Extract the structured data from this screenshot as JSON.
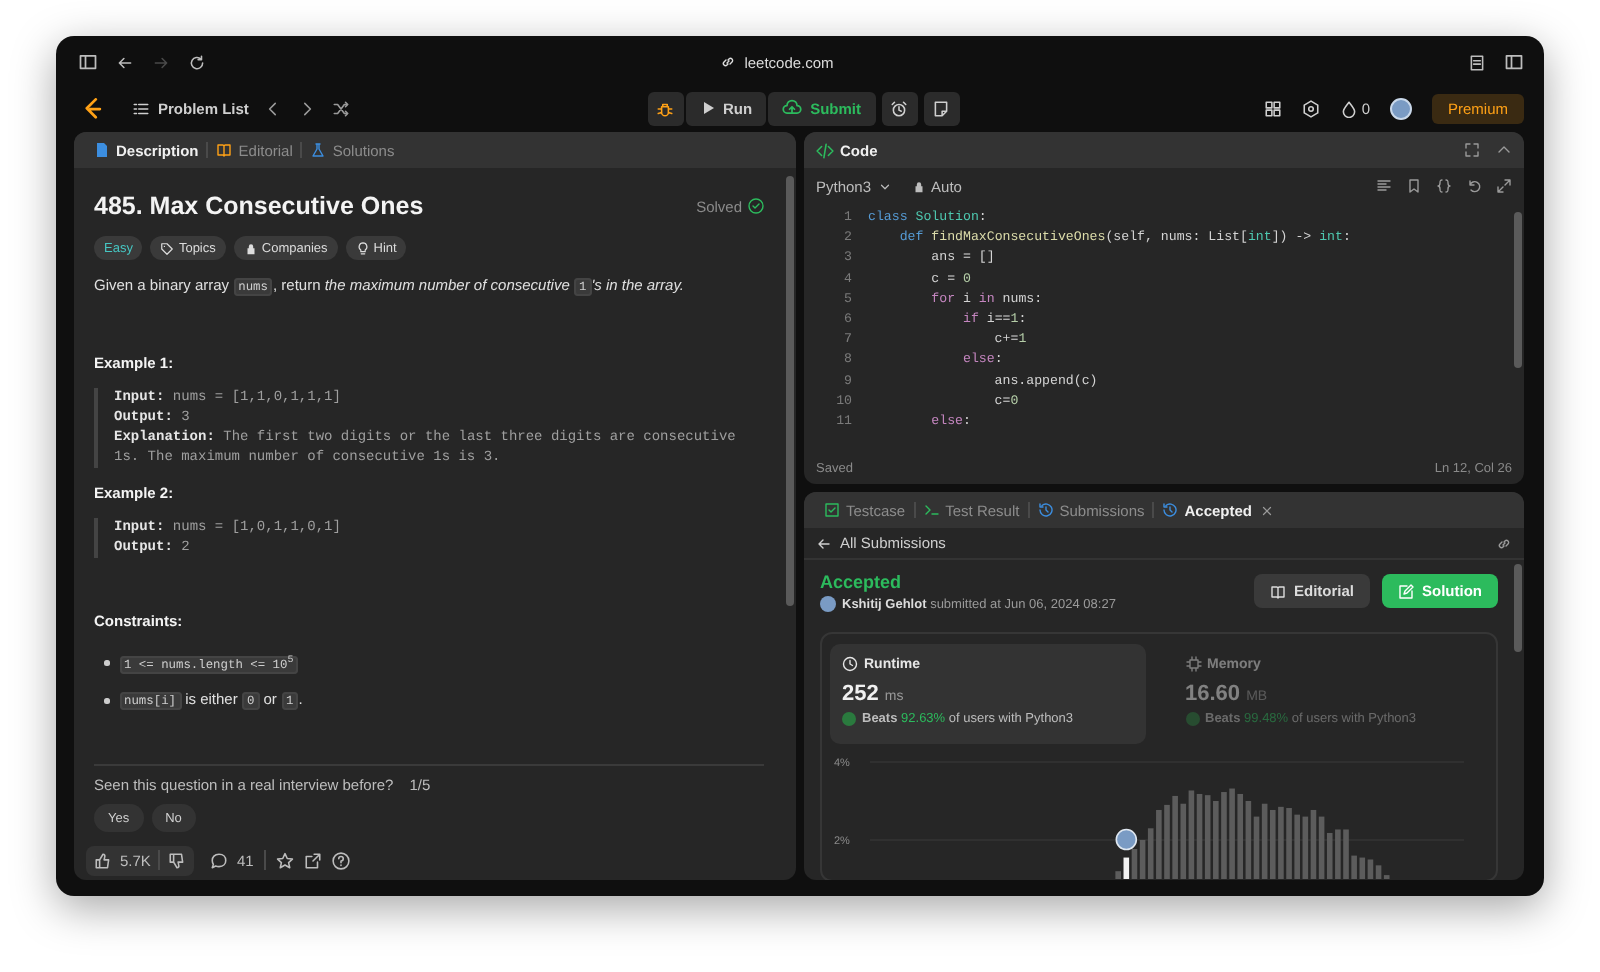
{
  "browser": {
    "url": "leetcode.com",
    "forward_disabled": true
  },
  "nav": {
    "problem_list": "Problem List",
    "run": "Run",
    "submit": "Submit",
    "streak_count": "0",
    "premium": "Premium"
  },
  "left_panel": {
    "tabs": [
      {
        "label": "Description",
        "selected": true
      },
      {
        "label": "Editorial",
        "selected": false
      },
      {
        "label": "Solutions",
        "selected": false
      }
    ],
    "title": "485. Max Consecutive Ones",
    "status": "Solved",
    "tags": [
      {
        "label": "Easy",
        "kind": "difficulty"
      },
      {
        "label": "Topics",
        "kind": "topics"
      },
      {
        "label": "Companies",
        "kind": "companies"
      },
      {
        "label": "Hint",
        "kind": "hint"
      }
    ],
    "statement": [
      {
        "text": "Given a binary array ",
        "kind": "text"
      },
      {
        "text": "nums",
        "kind": "code"
      },
      {
        "text": ", return ",
        "kind": "text"
      },
      {
        "text": "the maximum number of consecutive ",
        "kind": "italic"
      },
      {
        "text": "1",
        "kind": "code"
      },
      {
        "text": "'s in the array.",
        "kind": "italic"
      }
    ],
    "examples": [
      {
        "heading": "Example 1:",
        "lines": [
          {
            "label": "Input:",
            "value": "nums = [1,1,0,1,1,1]"
          },
          {
            "label": "Output:",
            "value": "3"
          },
          {
            "label": "Explanation:",
            "value": "The first two digits or the last three digits are consecutive 1s. The maximum number of consecutive 1s is 3."
          }
        ]
      },
      {
        "heading": "Example 2:",
        "lines": [
          {
            "label": "Input:",
            "value": "nums = [1,0,1,1,0,1]"
          },
          {
            "label": "Output:",
            "value": "2"
          }
        ]
      }
    ],
    "constraints_heading": "Constraints:",
    "constraints": [
      [
        {
          "text": "1 <= nums.length <= 10$^{5}$",
          "kind": "code"
        }
      ],
      [
        {
          "text": "nums[i]",
          "kind": "code"
        },
        {
          "text": " is either ",
          "kind": "text"
        },
        {
          "text": "0",
          "kind": "code"
        },
        {
          "text": " or ",
          "kind": "text"
        },
        {
          "text": "1",
          "kind": "code"
        },
        {
          "text": ".",
          "kind": "text"
        }
      ]
    ],
    "interview": {
      "question": "Seen this question in a real interview before?",
      "count": "1/5",
      "answers": [
        "Yes",
        "No"
      ]
    },
    "footer": {
      "likes": "5.7K",
      "comments": "41"
    }
  },
  "editor": {
    "title": "Code",
    "language": "Python3",
    "mode": "Auto",
    "lines": [
      {
        "number": "1",
        "tokens": [
          {
            "text": "class",
            "kind": "keyword"
          },
          {
            "text": " Solution",
            "kind": "type"
          },
          {
            "text": ":",
            "kind": "plain"
          }
        ]
      },
      {
        "number": "2",
        "tokens": [
          {
            "text": "    def",
            "kind": "keyword"
          },
          {
            "text": " findMaxConsecutiveOnes",
            "kind": "function"
          },
          {
            "text": "(self, nums: List[",
            "kind": "plain"
          },
          {
            "text": "int",
            "kind": "type"
          },
          {
            "text": "]) -> ",
            "kind": "plain"
          },
          {
            "text": "int",
            "kind": "type"
          },
          {
            "text": ":",
            "kind": "plain"
          }
        ]
      },
      {
        "number": "3",
        "tokens": [
          {
            "text": "        ans = []",
            "kind": "plain"
          }
        ]
      },
      {
        "number": "4",
        "tokens": [
          {
            "text": "        c = ",
            "kind": "plain"
          },
          {
            "text": "0",
            "kind": "number"
          }
        ]
      },
      {
        "number": "5",
        "tokens": [
          {
            "text": "        for",
            "kind": "control"
          },
          {
            "text": " i ",
            "kind": "plain"
          },
          {
            "text": "in",
            "kind": "control"
          },
          {
            "text": " nums:",
            "kind": "plain"
          }
        ]
      },
      {
        "number": "6",
        "tokens": [
          {
            "text": "            if",
            "kind": "control"
          },
          {
            "text": " i==",
            "kind": "plain"
          },
          {
            "text": "1",
            "kind": "number"
          },
          {
            "text": ":",
            "kind": "plain"
          }
        ]
      },
      {
        "number": "7",
        "tokens": [
          {
            "text": "                c+=",
            "kind": "plain"
          },
          {
            "text": "1",
            "kind": "number"
          }
        ]
      },
      {
        "number": "8",
        "tokens": [
          {
            "text": "            else",
            "kind": "control"
          },
          {
            "text": ":",
            "kind": "plain"
          }
        ]
      },
      {
        "number": "9",
        "tokens": [
          {
            "text": "                ans.append(c)",
            "kind": "plain"
          }
        ]
      },
      {
        "number": "10",
        "tokens": [
          {
            "text": "                c=",
            "kind": "plain"
          },
          {
            "text": "0",
            "kind": "number"
          }
        ]
      },
      {
        "number": "11",
        "tokens": [
          {
            "text": "        else",
            "kind": "control"
          },
          {
            "text": ":",
            "kind": "plain"
          }
        ]
      }
    ],
    "status": "Saved",
    "cursor": "Ln 12, Col 26"
  },
  "results": {
    "tabs": [
      {
        "label": "Testcase",
        "kind": "testcase",
        "selected": false,
        "closable": false
      },
      {
        "label": "Test Result",
        "kind": "terminal",
        "selected": false,
        "closable": false
      },
      {
        "label": "Submissions",
        "kind": "history",
        "selected": false,
        "closable": false
      },
      {
        "label": "Accepted",
        "kind": "history",
        "selected": true,
        "closable": true
      }
    ],
    "back_link": "All Submissions",
    "verdict": "Accepted",
    "user": "Kshitij Gehlot",
    "submitted": "submitted at Jun 06, 2024 08:27",
    "buttons": [
      {
        "label": "Editorial",
        "kind": "secondary"
      },
      {
        "label": "Solution",
        "kind": "primary"
      }
    ],
    "metrics": [
      {
        "name": "Runtime",
        "kind": "clock",
        "value": "252",
        "unit": "ms",
        "beats_label": "Beats",
        "beats_percent": "92.63%",
        "beats_text": "of users with Python3",
        "selected": true
      },
      {
        "name": "Memory",
        "kind": "chip",
        "value": "16.60",
        "unit": "MB",
        "beats_label": "Beats",
        "beats_percent": "99.48%",
        "beats_text": "of users with Python3",
        "selected": false
      }
    ],
    "chart_data": {
      "type": "bar",
      "ylim": [
        1,
        4
      ],
      "yticks": [
        {
          "value": 2,
          "label": "2%"
        },
        {
          "value": 4,
          "label": "4%"
        }
      ],
      "series": [
        {
          "color": "#5c5c5c",
          "values": [
            null,
            null,
            null,
            null,
            null,
            null,
            null,
            null,
            null,
            null,
            null,
            null,
            null,
            null,
            null,
            null,
            null,
            null,
            null,
            null,
            null,
            null,
            null,
            null,
            null,
            null,
            null,
            null,
            null,
            null,
            1.2,
            null,
            1.77,
            2.0,
            2.3,
            2.77,
            2.9,
            3.13,
            2.93,
            3.27,
            3.18,
            3.15,
            3.0,
            3.23,
            3.32,
            3.18,
            3.0,
            2.6,
            2.93,
            2.77,
            2.85,
            2.82,
            2.65,
            2.6,
            2.77,
            2.6,
            2.18,
            2.27,
            2.27,
            1.6,
            1.55,
            1.5,
            1.35,
            1.1,
            null,
            null,
            null,
            null,
            null,
            null,
            null,
            null,
            null
          ]
        },
        {
          "color": "#f2f2f2",
          "values": [
            null,
            null,
            null,
            null,
            null,
            null,
            null,
            null,
            null,
            null,
            null,
            null,
            null,
            null,
            null,
            null,
            null,
            null,
            null,
            null,
            null,
            null,
            null,
            null,
            null,
            null,
            null,
            null,
            null,
            null,
            null,
            1.55,
            null,
            null,
            null,
            null,
            null,
            null,
            null,
            null,
            null,
            null,
            null,
            null,
            null,
            null,
            null,
            null,
            null,
            null,
            null,
            null,
            null,
            null,
            null,
            null,
            null,
            null,
            null,
            null,
            null,
            null,
            null,
            null,
            null,
            null,
            null,
            null,
            null,
            null,
            null,
            null,
            null
          ]
        }
      ]
    }
  }
}
